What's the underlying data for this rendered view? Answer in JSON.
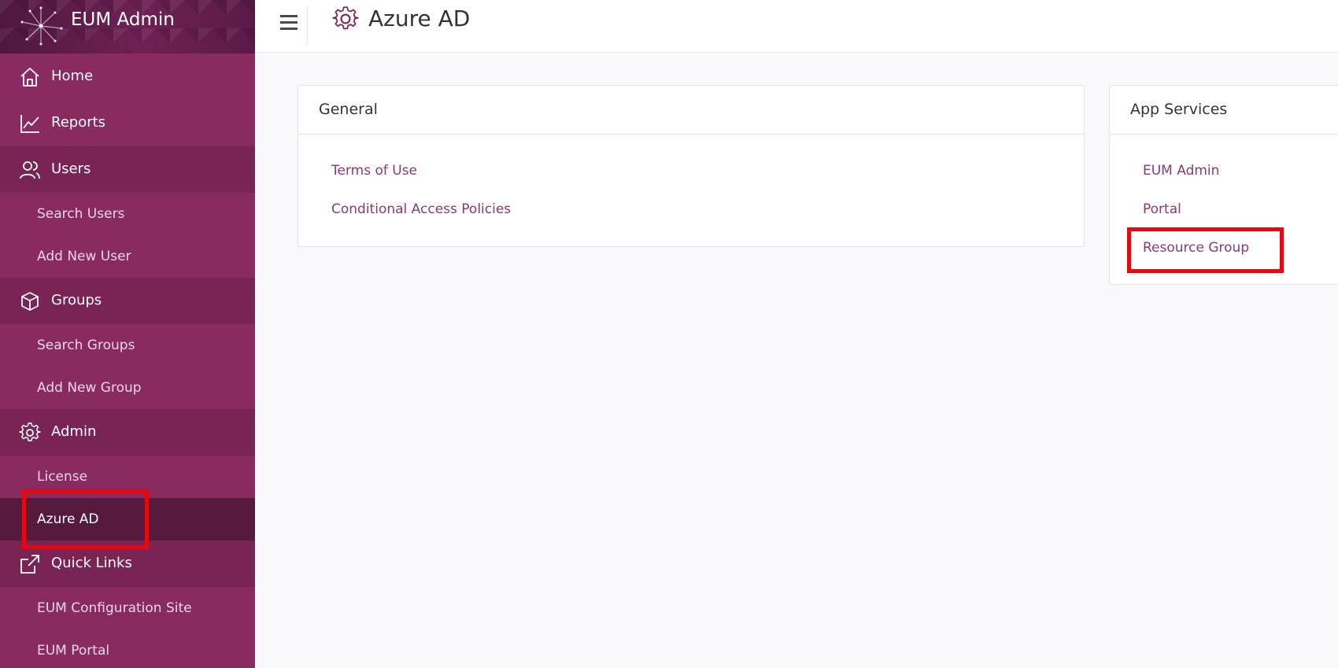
{
  "app": {
    "name": "EUM Admin"
  },
  "sidebar": {
    "sections": [
      {
        "label": "Home",
        "icon": "home-icon",
        "style": "plain"
      },
      {
        "label": "Reports",
        "icon": "chart-line-icon",
        "style": "plain"
      },
      {
        "label": "Users",
        "icon": "users-icon",
        "style": "dark",
        "items": [
          "Search Users",
          "Add New User"
        ]
      },
      {
        "label": "Groups",
        "icon": "box-icon",
        "style": "dark",
        "items": [
          "Search Groups",
          "Add New Group"
        ]
      },
      {
        "label": "Admin",
        "icon": "gear-icon",
        "style": "dark",
        "items": [
          "License",
          "Azure AD"
        ],
        "active_item": "Azure AD"
      },
      {
        "label": "Quick Links",
        "icon": "external-link-icon",
        "style": "dark",
        "items": [
          "EUM Configuration Site",
          "EUM Portal"
        ]
      }
    ]
  },
  "header": {
    "title": "Azure AD",
    "icon": "gear-icon"
  },
  "cards": {
    "general": {
      "title": "General",
      "links": [
        "Terms of Use",
        "Conditional Access Policies"
      ]
    },
    "app_services": {
      "title": "App Services",
      "links": [
        "EUM Admin",
        "Portal",
        "Resource Group"
      ]
    }
  },
  "colors": {
    "sidebar": "#892a60",
    "sidebar_section": "#7a2456",
    "sidebar_active": "#571a3f",
    "link": "#893a73",
    "highlight": "#e5090f"
  }
}
